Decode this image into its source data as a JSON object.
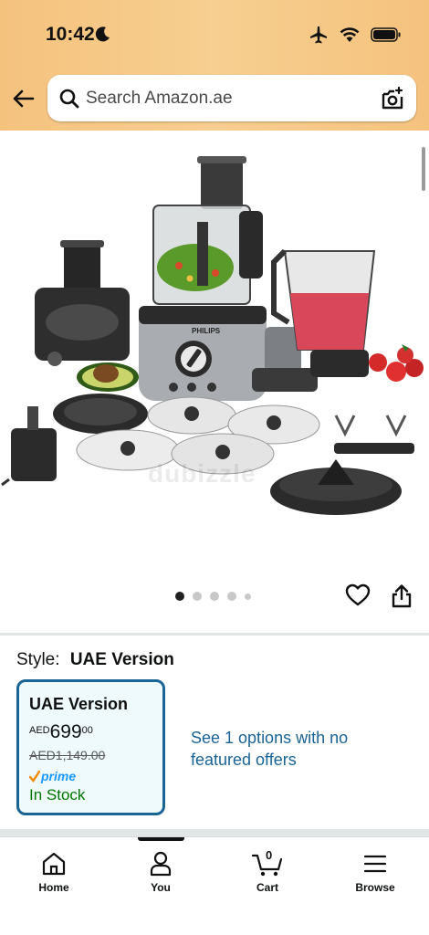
{
  "status_bar": {
    "time": "10:42"
  },
  "header": {
    "back_icon": "arrow-left-icon",
    "search": {
      "placeholder": "Search Amazon.ae",
      "value": ""
    },
    "camera_icon": "camera-scan-icon"
  },
  "product": {
    "image_alt": "Philips food processor with accessories",
    "image_brand_text": "PHILIPS",
    "watermark": "dubizzle",
    "carousel": {
      "total_dots": 5,
      "active_index": 0
    }
  },
  "style": {
    "label": "Style:",
    "value": "UAE Version"
  },
  "variant": {
    "name": "UAE Version",
    "currency": "AED",
    "price_whole": "699",
    "price_fraction": "00",
    "list_price": "AED1,149.00",
    "prime_label": "prime",
    "stock": "In Stock"
  },
  "more_options": "See 1 options with no featured offers",
  "tabs": [
    {
      "label": "Home",
      "icon": "home-icon"
    },
    {
      "label": "You",
      "icon": "person-icon"
    },
    {
      "label": "Cart",
      "icon": "cart-icon",
      "count": "0"
    },
    {
      "label": "Browse",
      "icon": "menu-icon"
    }
  ],
  "colors": {
    "header_bg": "#f5c27e",
    "link": "#1a6496",
    "card_border": "#1a6496",
    "card_bg": "#effafd",
    "in_stock": "#007600",
    "prime_blue": "#1a98ff"
  }
}
